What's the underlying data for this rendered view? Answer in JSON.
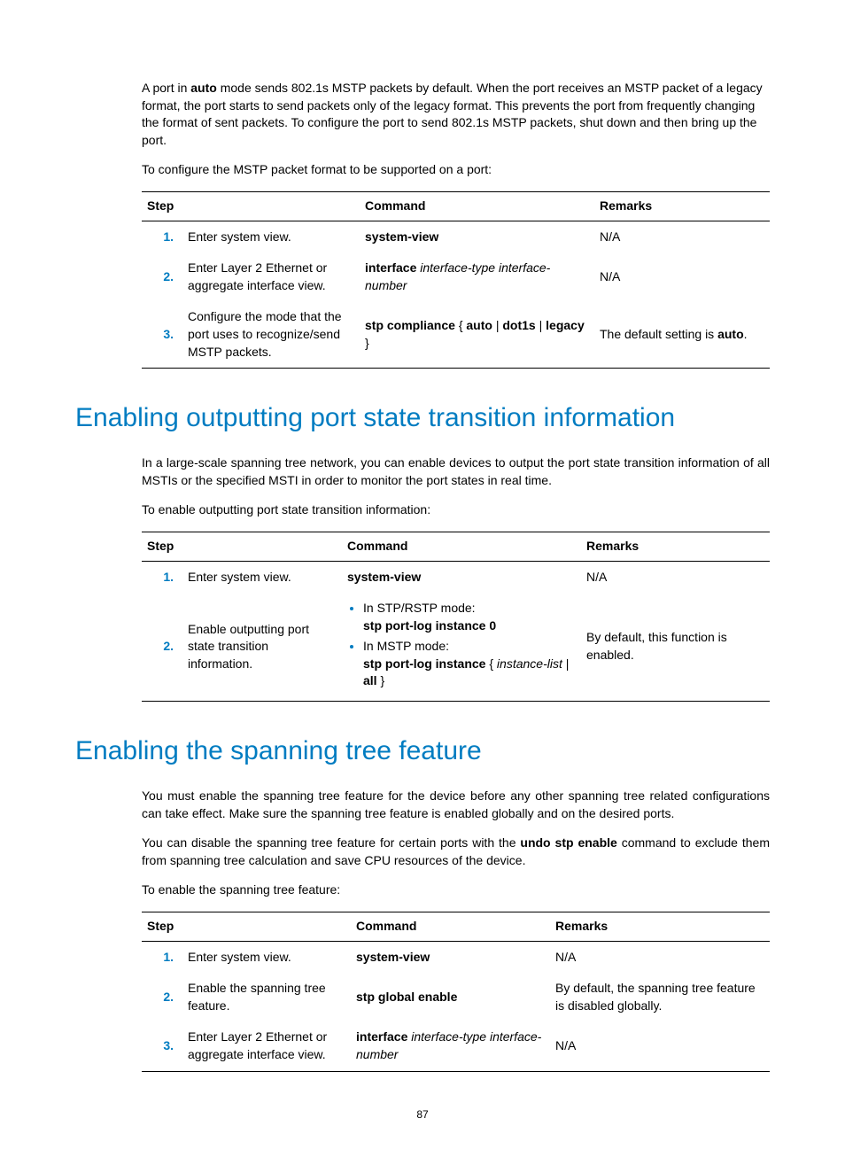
{
  "intro": {
    "p1_pre": "A port in ",
    "p1_bold": "auto",
    "p1_post": " mode sends 802.1s MSTP packets by default. When the port receives an MSTP packet of a legacy format, the port starts to send packets only of the legacy format. This prevents the port from frequently changing the format of sent packets. To configure the port to send 802.1s MSTP packets, shut down and then bring up the port.",
    "p2": "To configure the MSTP packet format to be supported on a port:"
  },
  "table_headers": {
    "step": "Step",
    "command": "Command",
    "remarks": "Remarks"
  },
  "table1": {
    "r1": {
      "n": "1.",
      "step": "Enter system view.",
      "cmd": "system-view",
      "rem": "N/A"
    },
    "r2": {
      "n": "2.",
      "step": "Enter Layer 2 Ethernet or aggregate interface view.",
      "cmd_b": "interface ",
      "cmd_i": "interface-type interface-number",
      "rem": "N/A"
    },
    "r3": {
      "n": "3.",
      "step": "Configure the mode that the port uses to recognize/send MSTP packets.",
      "cmd_b1": "stp compliance ",
      "cmd_t1": "{ ",
      "cmd_b2": "auto",
      "cmd_t2": " | ",
      "cmd_b3": "dot1s",
      "cmd_t3": " | ",
      "cmd_b4": "legacy",
      "cmd_t4": " }",
      "rem_pre": "The default setting is ",
      "rem_b": "auto",
      "rem_post": "."
    }
  },
  "section1": {
    "heading": "Enabling outputting port state transition information",
    "p1": "In a large-scale spanning tree network, you can enable devices to output the port state transition information of all MSTIs or the specified MSTI in order to monitor the port states in real time.",
    "p2": "To enable outputting port state transition information:"
  },
  "table2": {
    "r1": {
      "n": "1.",
      "step": "Enter system view.",
      "cmd": "system-view",
      "rem": "N/A"
    },
    "r2": {
      "n": "2.",
      "step": "Enable outputting port state transition information.",
      "li1_t": "In STP/RSTP mode:",
      "li1_b": "stp port-log instance 0",
      "li2_t": "In MSTP mode:",
      "li2_b1": "stp port-log instance ",
      "li2_t2": "{ ",
      "li2_i": "instance-list",
      "li2_t3": " | ",
      "li2_b2": "all",
      "li2_t4": " }",
      "rem": "By default, this function is enabled."
    }
  },
  "section2": {
    "heading": "Enabling the spanning tree feature",
    "p1": "You must enable the spanning tree feature for the device before any other spanning tree related configurations can take effect. Make sure the spanning tree feature is enabled globally and on the desired ports.",
    "p2_pre": "You can disable the spanning tree feature for certain ports with the ",
    "p2_b": "undo stp enable",
    "p2_post": " command to exclude them from spanning tree calculation and save CPU resources of the device.",
    "p3": "To enable the spanning tree feature:"
  },
  "table3": {
    "r1": {
      "n": "1.",
      "step": "Enter system view.",
      "cmd": "system-view",
      "rem": "N/A"
    },
    "r2": {
      "n": "2.",
      "step": "Enable the spanning tree feature.",
      "cmd": "stp global enable",
      "rem": "By default, the spanning tree feature is disabled globally."
    },
    "r3": {
      "n": "3.",
      "step": "Enter Layer 2 Ethernet or aggregate interface view.",
      "cmd_b": "interface ",
      "cmd_i": "interface-type interface-number",
      "rem": "N/A"
    }
  },
  "page_number": "87"
}
